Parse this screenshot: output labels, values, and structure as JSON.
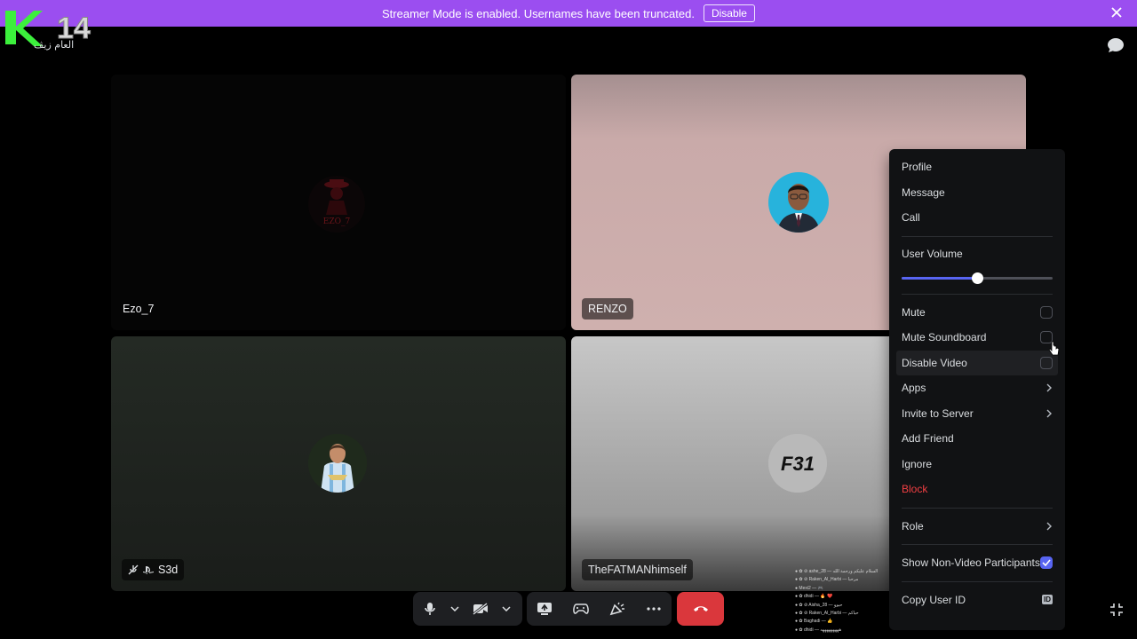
{
  "banner": {
    "message": "Streamer Mode is enabled. Usernames have been truncated.",
    "disable_label": "Disable",
    "color": "#9b4ef0"
  },
  "logo": {
    "text": "K 14"
  },
  "channel": {
    "label": "العام زيڤ"
  },
  "tiles": [
    {
      "name": "Ezo_7",
      "avatar_text": "EZO_7"
    },
    {
      "name": "RENZO"
    },
    {
      "name": "S3d"
    },
    {
      "name": "TheFATMANhimself",
      "avatar_text": "F31"
    }
  ],
  "overlay_chat": {
    "lines": [
      "● ✿ ⊘ ashe_28 — السلام عليكم ورحمة الله",
      "● ✿ ⊘ Raken_Al_Harbi — مرحبا",
      "● Mexi2 — 🎮",
      "● ✿ dhidi — 🔥 ❤️",
      "● ✿ ⊘ Aisha_28 — حيوو",
      "● ✿ ⊘ Raken_Al_Harbi — حياكم",
      "● ✿ Baghadi — 👍",
      "● ✿ dhidi — هههههههههه"
    ]
  },
  "menu": {
    "items_top": [
      "Profile",
      "Message",
      "Call"
    ],
    "user_volume_label": "User Volume",
    "user_volume_percent": 50,
    "toggles": [
      {
        "label": "Mute",
        "checked": false
      },
      {
        "label": "Mute Soundboard",
        "checked": false
      },
      {
        "label": "Disable Video",
        "checked": false
      }
    ],
    "submenus": [
      "Apps",
      "Invite to Server"
    ],
    "items_mid": [
      "Add Friend",
      "Ignore"
    ],
    "block_label": "Block",
    "role_label": "Role",
    "show_non_video_label": "Show Non-Video Participants",
    "show_non_video_checked": true,
    "copy_id_label": "Copy User ID",
    "id_badge": "ID"
  },
  "colors": {
    "accent": "#5865f2",
    "danger": "#f23f43",
    "end_call": "#da373c"
  }
}
